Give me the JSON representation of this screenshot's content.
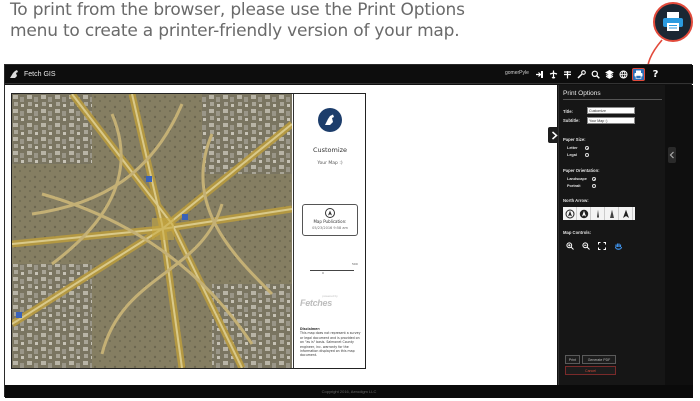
{
  "caption": {
    "line1": "To print from the browser, please use the Print Options",
    "line2": "menu to create a printer-friendly version of your map."
  },
  "app": {
    "name": "Fetch GIS",
    "user": "gomerPyle",
    "footer": "Copyright 2016, Aerodigm LLC"
  },
  "toolbar": {
    "icons": [
      "sign-in-icon",
      "airplane-icon",
      "tower-icon",
      "wrench-icon",
      "search-icon",
      "layers-icon",
      "globe-icon",
      "print-icon",
      "help-icon"
    ],
    "active_icon": "print-icon",
    "help_label": "?"
  },
  "legend": {
    "title": "Customize",
    "subtitle": "Your Map :)",
    "publication_label": "Map Publication:",
    "publication_date": "05/23/2016 9:58 am",
    "scale_zero": "0",
    "scale_max": "500",
    "powered_small": "powered by",
    "powered_big": "Fetches",
    "disclaimer_title": "Disclaimer:",
    "disclaimer_text": "This map does not represent a survey or legal document and is provided on an \"as is\" basis. Salmonet County engineer, inc. warranty for the information displayed on this map document."
  },
  "print_options": {
    "title": "Print Options",
    "title_label": "Title:",
    "title_value": "Customize",
    "subtitle_label": "Subtitle:",
    "subtitle_value": "Your Map :)",
    "paper_size_label": "Paper Size:",
    "paper_sizes": [
      "Letter",
      "Legal"
    ],
    "paper_size_selected": "Letter",
    "orientation_label": "Paper Orientation:",
    "orientations": [
      "Landscape",
      "Portrait"
    ],
    "orientation_selected": "Landscape",
    "north_arrow_label": "North Arrow:",
    "map_controls_label": "Map Controls:",
    "print_button": "Print",
    "pdf_button": "Generate PDF",
    "cancel_button": "Cancel"
  },
  "colors": {
    "accent": "#2b6fb8",
    "callout": "#e24a3b",
    "panel_bg": "#161616"
  }
}
